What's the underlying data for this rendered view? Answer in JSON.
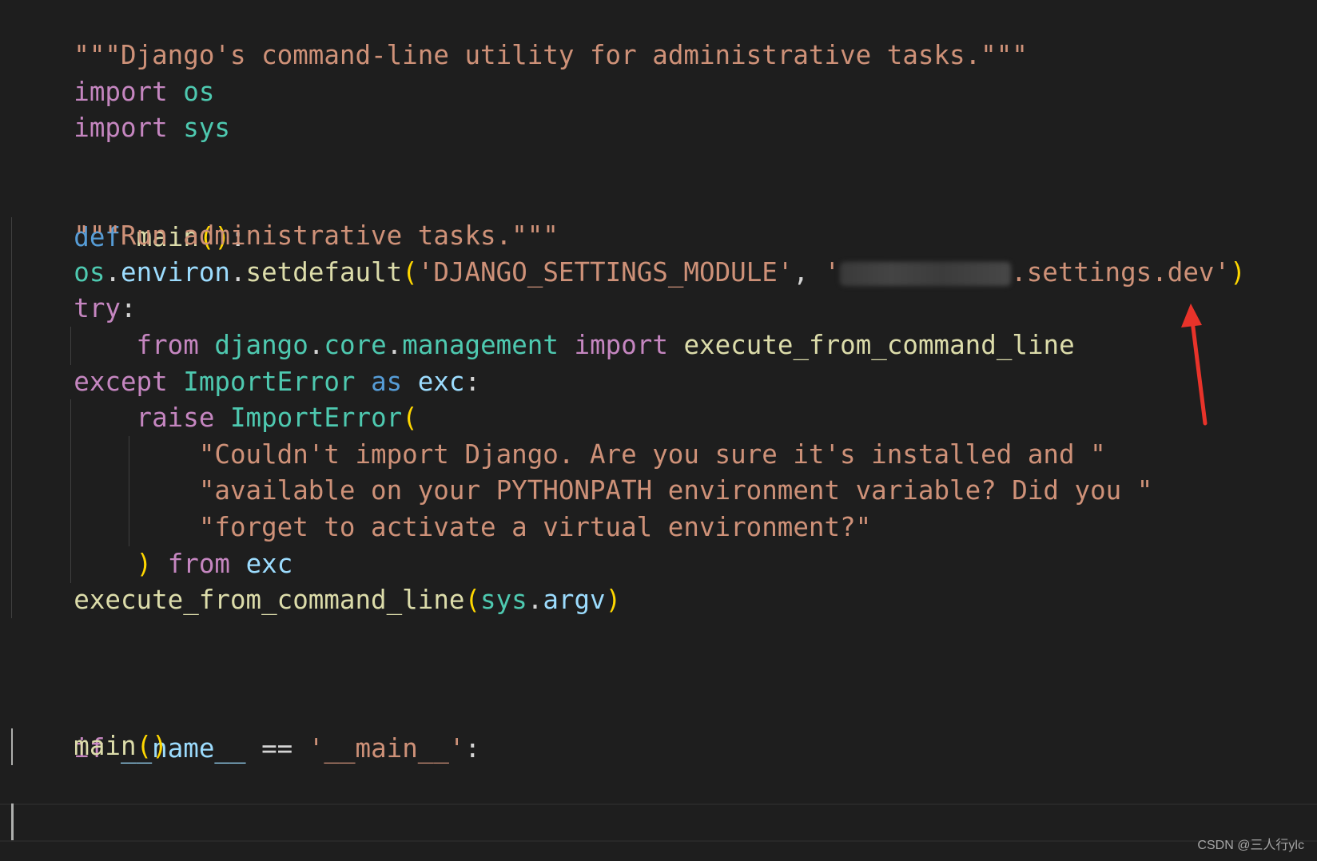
{
  "code": {
    "l1": {
      "docstring": "\"\"\"Django's command-line utility for administrative tasks.\"\"\""
    },
    "l2": {
      "kw": "import",
      "mod": "os"
    },
    "l3": {
      "kw": "import",
      "mod": "sys"
    },
    "l6": {
      "kw": "def",
      "fn": "main",
      "open": "(",
      "close": ")",
      "colon": ":"
    },
    "l7": {
      "docstring": "\"\"\"Run administrative tasks.\"\"\""
    },
    "l8": {
      "mod": "os",
      "dot1": ".",
      "attr": "environ",
      "dot2": ".",
      "fn": "setdefault",
      "open": "(",
      "arg1": "'DJANGO_SETTINGS_MODULE'",
      "comma": ", ",
      "quote": "'",
      "arg2_suffix": ".settings.dev'",
      "close": ")"
    },
    "l9": {
      "kw": "try",
      "colon": ":"
    },
    "l10": {
      "kw1": "from",
      "mod1": "django",
      "dot1": ".",
      "mod2": "core",
      "dot2": ".",
      "mod3": "management",
      "kw2": "import",
      "fn": "execute_from_command_line"
    },
    "l11": {
      "kw1": "except",
      "cls": "ImportError",
      "kw2": "as",
      "var": "exc",
      "colon": ":"
    },
    "l12": {
      "kw": "raise",
      "cls": "ImportError",
      "open": "("
    },
    "l13": {
      "str": "\"Couldn't import Django. Are you sure it's installed and \""
    },
    "l14": {
      "str": "\"available on your PYTHONPATH environment variable? Did you \""
    },
    "l15": {
      "str": "\"forget to activate a virtual environment?\""
    },
    "l16": {
      "close": ")",
      "kw": "from",
      "var": "exc"
    },
    "l17": {
      "fn": "execute_from_command_line",
      "open": "(",
      "mod": "sys",
      "dot": ".",
      "attr": "argv",
      "close": ")"
    },
    "l20": {
      "kw": "if",
      "var": "__name__",
      "op": " == ",
      "str": "'__main__'",
      "colon": ":"
    },
    "l21": {
      "fn": "main",
      "open": "(",
      "close": ")"
    }
  },
  "watermark": "CSDN @三人行ylc",
  "colors": {
    "background": "#1e1e1e",
    "keyword_purple": "#c586c0",
    "keyword_blue": "#569cd6",
    "string": "#ce9178",
    "module": "#4ec9b0",
    "function": "#dcdcaa",
    "variable": "#9cdcfe",
    "bracket": "#ffd700",
    "annotation_arrow": "#e8332a"
  }
}
